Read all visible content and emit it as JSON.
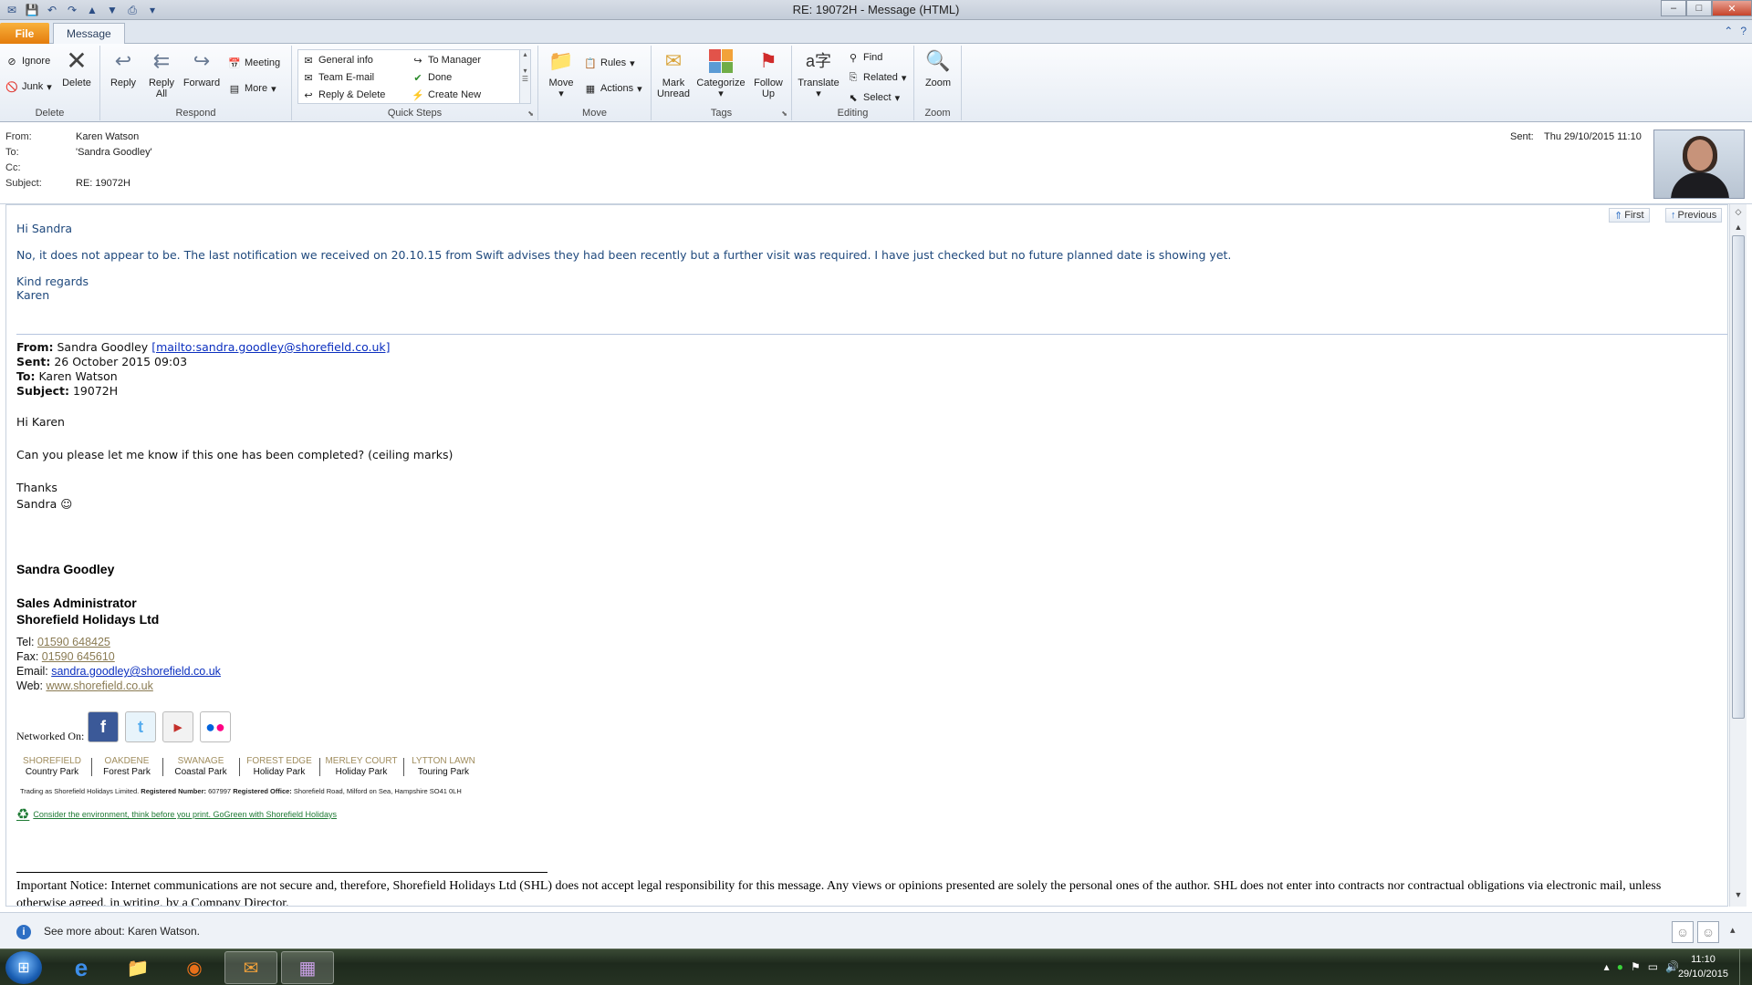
{
  "window": {
    "title": "RE: 19072H - Message (HTML)",
    "controls": {
      "minimize": "–",
      "maximize": "□",
      "close": "✕"
    }
  },
  "tabs": {
    "file": "File",
    "message": "Message"
  },
  "ribbon": {
    "delete_group": {
      "label": "Delete",
      "ignore": "Ignore",
      "junk": "Junk",
      "delete": "Delete"
    },
    "respond_group": {
      "label": "Respond",
      "reply": "Reply",
      "reply_all": "Reply All",
      "forward": "Forward",
      "meeting": "Meeting",
      "more": "More"
    },
    "quick_steps": {
      "label": "Quick Steps",
      "items": [
        "General info",
        "Team E-mail",
        "Reply & Delete",
        "To Manager",
        "Done",
        "Create New"
      ]
    },
    "move_group": {
      "label": "Move",
      "move": "Move",
      "rules": "Rules",
      "actions": "Actions"
    },
    "tags_group": {
      "label": "Tags",
      "mark_unread": "Mark Unread",
      "categorize": "Categorize",
      "follow_up": "Follow Up"
    },
    "editing_group": {
      "label": "Editing",
      "translate": "Translate",
      "find": "Find",
      "related": "Related",
      "select": "Select"
    },
    "zoom_group": {
      "label": "Zoom",
      "zoom": "Zoom"
    }
  },
  "header": {
    "from_label": "From:",
    "from": "Karen Watson",
    "to_label": "To:",
    "to": "'Sandra Goodley'",
    "cc_label": "Cc:",
    "cc": "",
    "subject_label": "Subject:",
    "subject": "RE: 19072H",
    "sent_label": "Sent:",
    "sent": "Thu 29/10/2015 11:10"
  },
  "nav": {
    "first": "First",
    "previous": "Previous"
  },
  "reply": {
    "greeting": "Hi Sandra",
    "body": "No, it does not appear to be. The last notification we received on 20.10.15 from Swift advises they had been recently but a further visit was required. I have just checked but no future planned date is showing yet.",
    "closing": "Kind regards",
    "name": "Karen"
  },
  "original": {
    "from_label": "From:",
    "from_name": "Sandra Goodley",
    "from_link": "[mailto:sandra.goodley@shorefield.co.uk]",
    "sent_label": "Sent:",
    "sent": "26 October 2015 09:03",
    "to_label": "To:",
    "to": "Karen Watson",
    "subject_label": "Subject:",
    "subject": "19072H",
    "greeting": "Hi Karen",
    "body": "Can you please let me know if this one has been completed?  (ceiling marks)",
    "thanks": "Thanks",
    "signoff": "Sandra ☺"
  },
  "signature": {
    "name": "Sandra Goodley",
    "title": "Sales Administrator",
    "company": "Shorefield Holidays Ltd",
    "tel_label": "Tel:",
    "tel": "01590 648425",
    "fax_label": "Fax:",
    "fax": "01590 645610",
    "email_label": "Email:",
    "email": "sandra.goodley@shorefield.co.uk",
    "web_label": "Web:",
    "web": "www.shorefield.co.uk",
    "networked": "Networked On:",
    "parks": [
      {
        "name": "SHOREFIELD",
        "type": "Country Park"
      },
      {
        "name": "OAKDENE",
        "type": "Forest Park"
      },
      {
        "name": "SWANAGE",
        "type": "Coastal Park"
      },
      {
        "name": "FOREST EDGE",
        "type": "Holiday Park"
      },
      {
        "name": "MERLEY COURT",
        "type": "Holiday Park"
      },
      {
        "name": "LYTTON LAWN",
        "type": "Touring Park"
      }
    ],
    "trading_prefix": "Trading as Shorefield Holidays Limited.",
    "reg_number_label": "Registered Number:",
    "reg_number": "607997",
    "reg_office_label": "Registered Office:",
    "reg_office": "Shorefield Road, Milford on Sea, Hampshire SO41 0LH",
    "gogreen": "Consider the environment, think before you print. GoGreen with Shorefield Holidays",
    "notice": "Important Notice: Internet communications are not secure and, therefore, Shorefield Holidays Ltd (SHL) does not accept legal responsibility for this message. Any views or opinions presented are solely the personal ones of the author. SHL does not enter into contracts nor contractual obligations via electronic mail, unless otherwise agreed, in writing, by a Company Director."
  },
  "people_pane": {
    "text": "See more about: Karen Watson."
  },
  "taskbar": {
    "time": "11:10",
    "date": "29/10/2015"
  },
  "colors": {
    "accent": "#1f497d",
    "file_tab": "#e47c0c",
    "link": "#0b2fbf"
  }
}
